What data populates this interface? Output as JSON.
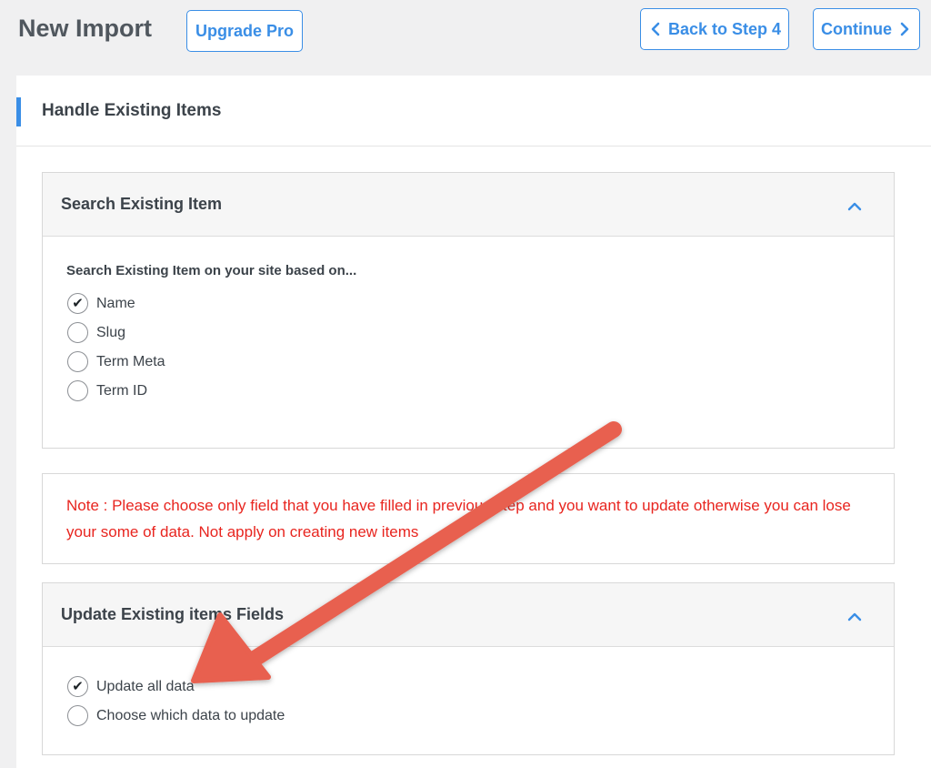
{
  "header": {
    "title": "New Import",
    "upgrade_label": "Upgrade Pro",
    "back_label": "Back to Step 4",
    "continue_label": "Continue"
  },
  "section": {
    "title": "Handle Existing Items"
  },
  "search_panel": {
    "title": "Search Existing Item",
    "field_label": "Search Existing Item on your site based on...",
    "options": [
      {
        "label": "Name",
        "checked": true
      },
      {
        "label": "Slug",
        "checked": false
      },
      {
        "label": "Term Meta",
        "checked": false
      },
      {
        "label": "Term ID",
        "checked": false
      }
    ]
  },
  "note": {
    "text": "Note : Please choose only field that you have filled in previous step and you want to update otherwise you can lose your some of data. Not apply on creating new items"
  },
  "update_panel": {
    "title": "Update Existing items Fields",
    "options": [
      {
        "label": "Update all data",
        "checked": true
      },
      {
        "label": "Choose which data to update",
        "checked": false
      }
    ]
  },
  "colors": {
    "accent": "#3a8ee6",
    "note": "#e8251f",
    "arrow": "#e8604f"
  },
  "icons": {
    "back": "chevron-left-icon",
    "continue": "chevron-right-icon",
    "collapse": "chevron-up-icon",
    "check": "check-icon"
  }
}
